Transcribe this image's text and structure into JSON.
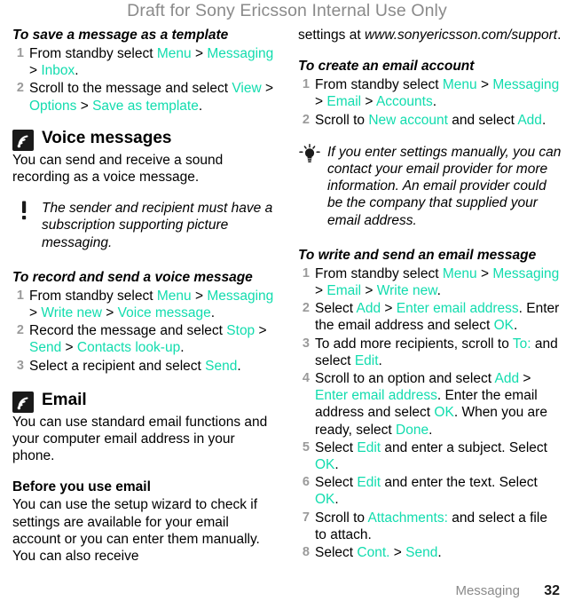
{
  "watermark": "Draft for Sony Ericsson Internal Use Only",
  "footer": {
    "chapter": "Messaging",
    "page_number": "32"
  },
  "colors": {
    "ui_term": "#12dcae",
    "step_number": "#9a9a9a",
    "watermark": "#8a8a8a",
    "icon_background": "#1a1a1a"
  },
  "left_column": {
    "proc_template": {
      "heading": "To save a message as a template",
      "steps": [
        {
          "parts": [
            {
              "t": "From standby select ",
              "ui": false
            },
            {
              "t": "Menu",
              "ui": true
            },
            {
              "t": " > ",
              "ui": false
            },
            {
              "t": "Messaging",
              "ui": true
            },
            {
              "t": " > ",
              "ui": false
            },
            {
              "t": "Inbox",
              "ui": true
            },
            {
              "t": ".",
              "ui": false
            }
          ]
        },
        {
          "parts": [
            {
              "t": "Scroll to the message and select ",
              "ui": false
            },
            {
              "t": "View",
              "ui": true
            },
            {
              "t": " > ",
              "ui": false
            },
            {
              "t": "Options",
              "ui": true
            },
            {
              "t": " > ",
              "ui": false
            },
            {
              "t": "Save as template",
              "ui": true
            },
            {
              "t": ".",
              "ui": false
            }
          ]
        }
      ]
    },
    "voice_messages": {
      "icon": "broadcast-waves-icon",
      "heading": "Voice messages",
      "body": "You can send and receive a sound recording as a voice message.",
      "note": {
        "icon": "exclamation-note-icon",
        "text": "The sender and recipient must have a subscription supporting picture messaging."
      }
    },
    "proc_voice": {
      "heading": "To record and send a voice message",
      "steps": [
        {
          "parts": [
            {
              "t": "From standby select ",
              "ui": false
            },
            {
              "t": "Menu",
              "ui": true
            },
            {
              "t": " > ",
              "ui": false
            },
            {
              "t": "Messaging",
              "ui": true
            },
            {
              "t": " > ",
              "ui": false
            },
            {
              "t": "Write new",
              "ui": true
            },
            {
              "t": " > ",
              "ui": false
            },
            {
              "t": "Voice message",
              "ui": true
            },
            {
              "t": ".",
              "ui": false
            }
          ]
        },
        {
          "parts": [
            {
              "t": "Record the message and select ",
              "ui": false
            },
            {
              "t": "Stop",
              "ui": true
            },
            {
              "t": " > ",
              "ui": false
            },
            {
              "t": "Send",
              "ui": true
            },
            {
              "t": " > ",
              "ui": false
            },
            {
              "t": "Contacts look-up",
              "ui": true
            },
            {
              "t": ".",
              "ui": false
            }
          ]
        },
        {
          "parts": [
            {
              "t": "Select a recipient and select ",
              "ui": false
            },
            {
              "t": "Send",
              "ui": true
            },
            {
              "t": ".",
              "ui": false
            }
          ]
        }
      ]
    },
    "email": {
      "icon": "broadcast-waves-icon",
      "heading": "Email",
      "body": "You can use standard email functions and your computer email address in your phone.",
      "sub_heading": "Before you use email",
      "sub_body": "You can use the setup wizard to check if settings are available for your email account or you can enter them manually. You can also receive"
    }
  },
  "right_column": {
    "continuation": {
      "prefix": "settings at ",
      "url": "www.sonyericsson.com/support",
      "suffix": "."
    },
    "proc_account": {
      "heading": "To create an email account",
      "steps": [
        {
          "parts": [
            {
              "t": "From standby select ",
              "ui": false
            },
            {
              "t": "Menu",
              "ui": true
            },
            {
              "t": " > ",
              "ui": false
            },
            {
              "t": "Messaging",
              "ui": true
            },
            {
              "t": " > ",
              "ui": false
            },
            {
              "t": "Email",
              "ui": true
            },
            {
              "t": " > ",
              "ui": false
            },
            {
              "t": "Accounts",
              "ui": true
            },
            {
              "t": ".",
              "ui": false
            }
          ]
        },
        {
          "parts": [
            {
              "t": "Scroll to ",
              "ui": false
            },
            {
              "t": "New account",
              "ui": true
            },
            {
              "t": " and select ",
              "ui": false
            },
            {
              "t": "Add",
              "ui": true
            },
            {
              "t": ".",
              "ui": false
            }
          ]
        }
      ]
    },
    "tip": {
      "icon": "lightbulb-tip-icon",
      "text": "If you enter settings manually, you can contact your email provider for more information. An email provider could be the company that supplied your email address."
    },
    "proc_write_email": {
      "heading": "To write and send an email message",
      "steps": [
        {
          "parts": [
            {
              "t": "From standby select ",
              "ui": false
            },
            {
              "t": "Menu",
              "ui": true
            },
            {
              "t": " > ",
              "ui": false
            },
            {
              "t": "Messaging",
              "ui": true
            },
            {
              "t": " > ",
              "ui": false
            },
            {
              "t": "Email",
              "ui": true
            },
            {
              "t": " > ",
              "ui": false
            },
            {
              "t": "Write new",
              "ui": true
            },
            {
              "t": ".",
              "ui": false
            }
          ]
        },
        {
          "parts": [
            {
              "t": "Select ",
              "ui": false
            },
            {
              "t": "Add",
              "ui": true
            },
            {
              "t": " > ",
              "ui": false
            },
            {
              "t": "Enter email address",
              "ui": true
            },
            {
              "t": ". Enter the email address and select ",
              "ui": false
            },
            {
              "t": "OK",
              "ui": true
            },
            {
              "t": ".",
              "ui": false
            }
          ]
        },
        {
          "parts": [
            {
              "t": " To add more recipients, scroll to ",
              "ui": false
            },
            {
              "t": "To:",
              "ui": true
            },
            {
              "t": " and select ",
              "ui": false
            },
            {
              "t": "Edit",
              "ui": true
            },
            {
              "t": ".",
              "ui": false
            }
          ]
        },
        {
          "parts": [
            {
              "t": "Scroll to an option and select ",
              "ui": false
            },
            {
              "t": "Add",
              "ui": true
            },
            {
              "t": " > ",
              "ui": false
            },
            {
              "t": "Enter email address",
              "ui": true
            },
            {
              "t": ". Enter the email address and select ",
              "ui": false
            },
            {
              "t": "OK",
              "ui": true
            },
            {
              "t": ". When you are ready, select ",
              "ui": false
            },
            {
              "t": "Done",
              "ui": true
            },
            {
              "t": ".",
              "ui": false
            }
          ]
        },
        {
          "parts": [
            {
              "t": "Select ",
              "ui": false
            },
            {
              "t": "Edit",
              "ui": true
            },
            {
              "t": " and enter a subject. Select ",
              "ui": false
            },
            {
              "t": "OK",
              "ui": true
            },
            {
              "t": ".",
              "ui": false
            }
          ]
        },
        {
          "parts": [
            {
              "t": "Select ",
              "ui": false
            },
            {
              "t": "Edit",
              "ui": true
            },
            {
              "t": " and enter the text. Select ",
              "ui": false
            },
            {
              "t": "OK",
              "ui": true
            },
            {
              "t": ".",
              "ui": false
            }
          ]
        },
        {
          "parts": [
            {
              "t": "Scroll to ",
              "ui": false
            },
            {
              "t": "Attachments:",
              "ui": true
            },
            {
              "t": " and select a file to attach.",
              "ui": false
            }
          ]
        },
        {
          "parts": [
            {
              "t": "Select ",
              "ui": false
            },
            {
              "t": "Cont.",
              "ui": true
            },
            {
              "t": " > ",
              "ui": false
            },
            {
              "t": "Send",
              "ui": true
            },
            {
              "t": ".",
              "ui": false
            }
          ]
        }
      ]
    }
  }
}
